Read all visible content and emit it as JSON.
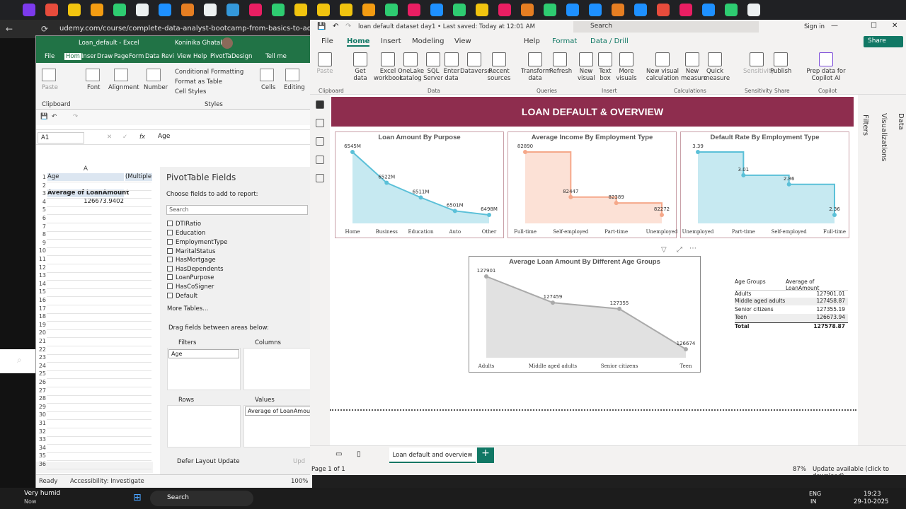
{
  "browser": {
    "url": "udemy.com/course/complete-data-analyst-bootcamp-from-basics-to-advanced/",
    "tab_colors": [
      "#7c3aed",
      "#e74c3c",
      "#f1c40f",
      "#f39c12",
      "#2ecc71",
      "#ecf0f1",
      "#1e90ff",
      "#e67e22",
      "#ecf0f1",
      "#3498db",
      "#e91e63",
      "#2ecc71",
      "#f1c40f",
      "#f1c40f",
      "#f1c40f",
      "#f39c12",
      "#2ecc71",
      "#e91e63",
      "#1e90ff",
      "#2ecc71",
      "#f1c40f",
      "#e91e63",
      "#e67e22",
      "#2ecc71",
      "#1e90ff",
      "#1e90ff",
      "#e67e22",
      "#1e90ff",
      "#e74c3c",
      "#e91e63",
      "#1e90ff",
      "#2ecc71",
      "#ecf0f1"
    ]
  },
  "excel": {
    "title": "Loan_default - Excel",
    "user": "Koninika Ghatak",
    "menu": [
      "File",
      "Hom",
      "Inser",
      "Draw",
      "Page",
      "Form",
      "Data",
      "Revi",
      "View",
      "Help",
      "PivotTa",
      "Design",
      "Tell me"
    ],
    "ribbon": {
      "paste": "Paste",
      "font": "Font",
      "alignment": "Alignment",
      "number": "Number",
      "conditional_formatting": "Conditional Formatting",
      "format_as_table": "Format as Table",
      "cell_styles": "Cell Styles",
      "cells": "Cells",
      "editing": "Editing",
      "clipboard": "Clipboard",
      "styles": "Styles"
    },
    "name_box": "A1",
    "formula": "Age",
    "column_a": "A",
    "cells": {
      "a1": "Age",
      "b1": "(Multiple",
      "a3": "Average of LoanAmount",
      "a4": "126673.9402"
    },
    "row_numbers": [
      "1",
      "2",
      "3",
      "4",
      "5",
      "6",
      "7",
      "8",
      "9",
      "10",
      "11",
      "12",
      "13",
      "14",
      "15",
      "16",
      "17",
      "18",
      "19",
      "20",
      "21",
      "22",
      "23",
      "24",
      "25",
      "26",
      "27",
      "28",
      "29",
      "30",
      "31",
      "32",
      "33",
      "34",
      "35",
      "36"
    ],
    "pivot": {
      "title": "PivotTable Fields",
      "choose": "Choose fields to add to report:",
      "search": "Search",
      "fields": [
        "DTIRatio",
        "Education",
        "EmploymentType",
        "MaritalStatus",
        "HasMortgage",
        "HasDependents",
        "LoanPurpose",
        "HasCoSigner",
        "Default"
      ],
      "more_tables": "More Tables...",
      "drag": "Drag fields between areas below:",
      "filters": "Filters",
      "columns": "Columns",
      "rows": "Rows",
      "values": "Values",
      "filter_chip": "Age",
      "values_chip": "Average of LoanAmount",
      "defer": "Defer Layout Update",
      "update": "Upd"
    },
    "status": {
      "ready": "Ready",
      "accessibility": "Accessibility: Investigate",
      "zoom": "100%"
    }
  },
  "pbi": {
    "file": "loan default dataset day1 • Last saved: Today at 12:01 AM",
    "search": "Search",
    "signin": "Sign in",
    "share": "Share",
    "tabs": [
      "File",
      "Home",
      "Insert",
      "Modeling",
      "View",
      "Help",
      "Format",
      "Data / Drill"
    ],
    "ribbon_buttons": [
      "Paste",
      "Get data",
      "Excel workbook",
      "OneLake catalog",
      "SQL Server",
      "Enter data",
      "Dataverse",
      "Recent sources",
      "Transform data",
      "Refresh",
      "New visual",
      "Text box",
      "More visuals",
      "New visual calculation",
      "New measure",
      "Quick measure",
      "Sensitivity",
      "Publish",
      "Prep data for Copilot AI"
    ],
    "groups": [
      "Clipboard",
      "Data",
      "Queries",
      "Insert",
      "Calculations",
      "Sensitivity",
      "Share",
      "Copilot"
    ],
    "banner": "LOAN DEFAULT & OVERVIEW",
    "right_panes": [
      "Filters",
      "Visualizations",
      "Data"
    ],
    "page_tab": "Loan default and overview",
    "page_of": "Page 1 of 1",
    "zoom": "87%",
    "update": "Update available (click to download)"
  },
  "chart_data": [
    {
      "type": "area",
      "title": "Loan Amount By Purpose",
      "categories": [
        "Home",
        "Business",
        "Education",
        "Auto",
        "Other"
      ],
      "values": [
        6545,
        6522,
        6511,
        6501,
        6498
      ],
      "labels": [
        "6545M",
        "6522M",
        "6511M",
        "6501M",
        "6498M"
      ],
      "color": "#5bc0d8"
    },
    {
      "type": "area",
      "title": "Average Income By Employment Type",
      "categories": [
        "Full-time",
        "Self-employed",
        "Part-time",
        "Unemployed"
      ],
      "values": [
        82890,
        82447,
        82389,
        82272
      ],
      "labels": [
        "82890",
        "82447",
        "82389",
        "82272"
      ],
      "color": "#f5a88a"
    },
    {
      "type": "area",
      "title": "Default Rate By Employment Type",
      "categories": [
        "Unemployed",
        "Part-time",
        "Self-employed",
        "Full-time"
      ],
      "values": [
        3.39,
        3.01,
        2.86,
        2.36
      ],
      "labels": [
        "3.39",
        "3.01",
        "2.86",
        "2.36"
      ],
      "color": "#5bc0d8"
    },
    {
      "type": "area",
      "title": "Average Loan Amount By Different Age Groups",
      "categories": [
        "Adults",
        "Middle aged adults",
        "Senior citizens",
        "Teen"
      ],
      "values": [
        127901,
        127459,
        127355,
        126674
      ],
      "labels": [
        "127901",
        "127459",
        "127355",
        "126674"
      ],
      "color": "#aaaaaa"
    },
    {
      "type": "table",
      "columns": [
        "Age Groups",
        "Average of LoanAmount"
      ],
      "rows": [
        [
          "Adults",
          "127901.01"
        ],
        [
          "Middle aged adults",
          "127458.87"
        ],
        [
          "Senior citizens",
          "127355.19"
        ],
        [
          "Teen",
          "126673.94"
        ]
      ],
      "total": [
        "Total",
        "127578.87"
      ]
    }
  ],
  "taskbar": {
    "weather": "Very humid",
    "weather_sub": "Now",
    "search": "Search",
    "lang": "ENG",
    "lang_sub": "IN",
    "time": "19:23",
    "date": "29-10-2025"
  }
}
